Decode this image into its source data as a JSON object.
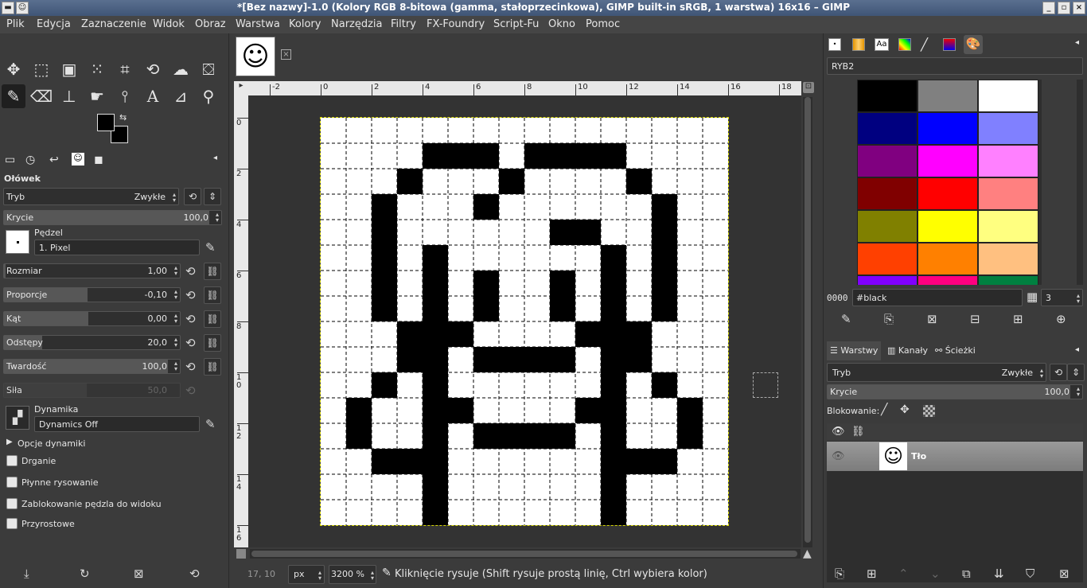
{
  "window": {
    "title": "*[Bez nazwy]-1.0 (Kolory RGB 8-bitowa (gamma, stałoprzecinkowa), GIMP built-in sRGB, 1 warstwa) 16x16 – GIMP"
  },
  "menu": [
    "Plik",
    "Edycja",
    "Zaznaczenie",
    "Widok",
    "Obraz",
    "Warstwa",
    "Kolory",
    "Narzędzia",
    "Filtry",
    "FX-Foundry",
    "Script-Fu",
    "Okno",
    "Pomoc"
  ],
  "tool_options": {
    "title": "Ołówek",
    "mode_label": "Tryb",
    "mode_value": "Zwykłe",
    "opacity_label": "Krycie",
    "opacity_value": "100,0",
    "brush_label": "Pędzel",
    "brush_value": "1. Pixel",
    "size_label": "Rozmiar",
    "size_value": "1,00",
    "aspect_label": "Proporcje",
    "aspect_value": "-0,10",
    "angle_label": "Kąt",
    "angle_value": "0,00",
    "spacing_label": "Odstępy",
    "spacing_value": "20,0",
    "hardness_label": "Twardość",
    "hardness_value": "100,0",
    "force_label": "Siła",
    "force_value": "50,0",
    "dynamics_label": "Dynamika",
    "dynamics_value": "Dynamics Off",
    "dynamics_options": "Opcje dynamiki",
    "jitter": "Drganie",
    "smooth": "Płynne rysowanie",
    "lock_brush": "Zablokowanie pędzla do widoku",
    "incremental": "Przyrostowe"
  },
  "canvas": {
    "hruler_labels": [
      "-2",
      "0",
      "2",
      "4",
      "6",
      "8",
      "10",
      "12",
      "14",
      "16",
      "18"
    ],
    "vruler_labels": [
      "0",
      "2",
      "4",
      "6",
      "8",
      "1\n0",
      "1\n2",
      "1\n4",
      "1\n6"
    ],
    "pixels": [
      [
        4,
        1
      ],
      [
        5,
        1
      ],
      [
        6,
        1
      ],
      [
        8,
        1
      ],
      [
        9,
        1
      ],
      [
        10,
        1
      ],
      [
        11,
        1
      ],
      [
        3,
        2
      ],
      [
        7,
        2
      ],
      [
        12,
        2
      ],
      [
        2,
        3
      ],
      [
        6,
        3
      ],
      [
        13,
        3
      ],
      [
        2,
        4
      ],
      [
        9,
        4
      ],
      [
        10,
        4
      ],
      [
        13,
        4
      ],
      [
        2,
        5
      ],
      [
        4,
        5
      ],
      [
        11,
        5
      ],
      [
        13,
        5
      ],
      [
        2,
        6
      ],
      [
        4,
        6
      ],
      [
        6,
        6
      ],
      [
        9,
        6
      ],
      [
        11,
        6
      ],
      [
        13,
        6
      ],
      [
        2,
        7
      ],
      [
        4,
        7
      ],
      [
        6,
        7
      ],
      [
        9,
        7
      ],
      [
        11,
        7
      ],
      [
        13,
        7
      ],
      [
        3,
        8
      ],
      [
        4,
        8
      ],
      [
        5,
        8
      ],
      [
        10,
        8
      ],
      [
        11,
        8
      ],
      [
        12,
        8
      ],
      [
        3,
        9
      ],
      [
        4,
        9
      ],
      [
        6,
        9
      ],
      [
        7,
        9
      ],
      [
        8,
        9
      ],
      [
        9,
        9
      ],
      [
        11,
        9
      ],
      [
        12,
        9
      ],
      [
        2,
        10
      ],
      [
        4,
        10
      ],
      [
        11,
        10
      ],
      [
        13,
        10
      ],
      [
        1,
        11
      ],
      [
        4,
        11
      ],
      [
        5,
        11
      ],
      [
        10,
        11
      ],
      [
        11,
        11
      ],
      [
        14,
        11
      ],
      [
        1,
        12
      ],
      [
        4,
        12
      ],
      [
        6,
        12
      ],
      [
        7,
        12
      ],
      [
        8,
        12
      ],
      [
        9,
        12
      ],
      [
        11,
        12
      ],
      [
        14,
        12
      ],
      [
        2,
        13
      ],
      [
        3,
        13
      ],
      [
        4,
        13
      ],
      [
        11,
        13
      ],
      [
        12,
        13
      ],
      [
        13,
        13
      ],
      [
        4,
        14
      ],
      [
        11,
        14
      ],
      [
        4,
        15
      ],
      [
        11,
        15
      ]
    ]
  },
  "status": {
    "coords": "17, 10",
    "unit": "px",
    "zoom": "3200 %",
    "message": "Kliknięcie rysuje (Shift rysuje prostą linię, Ctrl wybiera kolor)"
  },
  "palette": {
    "name": "RYB2",
    "index": "0000",
    "color_name": "#black",
    "columns": "3",
    "colors": [
      "#000000",
      "#808080",
      "#ffffff",
      "#000080",
      "#0000ff",
      "#8080ff",
      "#800080",
      "#ff00ff",
      "#ff80ff",
      "#800000",
      "#ff0000",
      "#ff8080",
      "#808000",
      "#ffff00",
      "#ffff80",
      "#ff4000",
      "#ff8000",
      "#ffc080",
      "#8000ff",
      "#ff0080",
      "#008040"
    ]
  },
  "layers": {
    "tabs": [
      "Warstwy",
      "Kanały",
      "Ścieżki"
    ],
    "mode_label": "Tryb",
    "mode_value": "Zwykłe",
    "opacity_label": "Krycie",
    "opacity_value": "100,0",
    "lock_label": "Blokowanie:",
    "layer_name": "Tło"
  }
}
